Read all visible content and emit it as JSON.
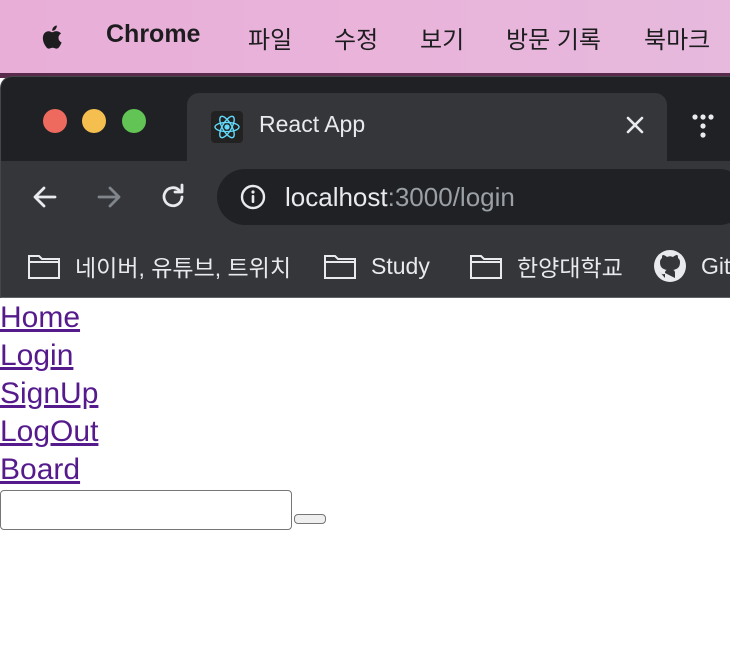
{
  "menubar": {
    "app_name": "Chrome",
    "items": [
      "파일",
      "수정",
      "보기",
      "방문 기록",
      "북마크"
    ]
  },
  "tab": {
    "title": "React App",
    "favicon": "react-logo-icon"
  },
  "omnibox": {
    "host": "localhost",
    "path": ":3000/login"
  },
  "bookmarks": [
    {
      "label": "네이버, 유튜브, 트위치",
      "icon": "folder-icon"
    },
    {
      "label": "Study",
      "icon": "folder-icon"
    },
    {
      "label": "한양대학교",
      "icon": "folder-icon"
    },
    {
      "label": "Git",
      "icon": "github-icon"
    }
  ],
  "page": {
    "links": [
      "Home",
      "Login",
      "SignUp",
      "LogOut",
      "Board"
    ],
    "input_value": "",
    "button_label": ""
  },
  "colors": {
    "link": "#551a8b",
    "traffic_red": "#ee6a5f",
    "traffic_yellow": "#f5bf4f",
    "traffic_green": "#61c454",
    "chrome_dark": "#202124",
    "chrome_toolbar": "#35363a"
  }
}
